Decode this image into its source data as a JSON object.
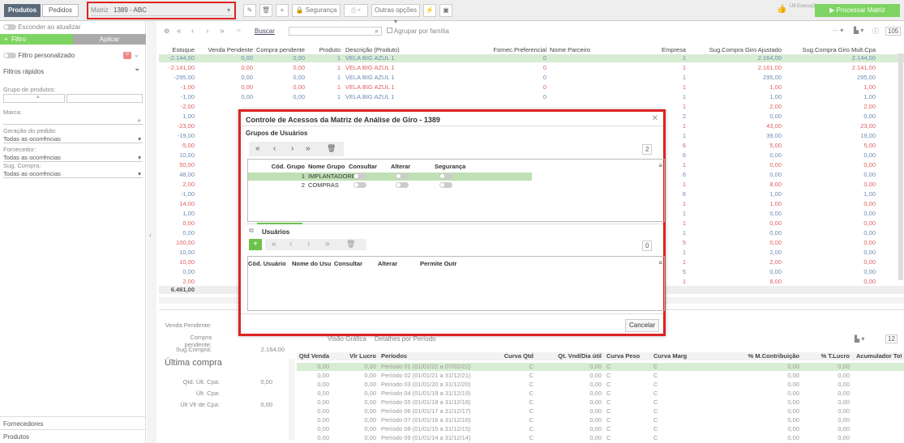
{
  "toolbar": {
    "tab_produtos": "Produtos",
    "tab_pedidos": "Pedidos",
    "matriz_label": "Matriz",
    "matriz_value": "1389 - ABC",
    "seguranca": "Segurança",
    "outras_opcoes": "Outras opções",
    "ult_execucao": "Últ Execução",
    "processar": "Processar Matriz"
  },
  "sidebar": {
    "esconder": "Esconder ao atualizar",
    "filtro_btn": "Filtro",
    "aplicar_btn": "Aplicar",
    "filtro_personalizado": "Filtro personalizado",
    "filtro_badge": "0",
    "filtros_rapidos": "Filtros rápidos",
    "grupo_produtos": "Grupo de produtos:",
    "marca": "Marca:",
    "geracao_pedido": "Geração do pedido:",
    "geracao_value": "Todas as ocorrências",
    "fornecedor": "Fornecedor:",
    "fornecedor_value": "Todas as ocorrências",
    "sug_compra": "Sug. Compra:",
    "sug_value": "Todas as ocorrências",
    "fornecedores": "Fornecedores",
    "produtos": "Produtos"
  },
  "grid_toolbar": {
    "buscar": "Buscar",
    "agrupar": "Agrupar por família",
    "count": "105"
  },
  "grid": {
    "headers": [
      "Estoque",
      "Venda Pendente",
      "Compra pendente",
      "Produto",
      "Descrição (Produto)",
      "Fornec.Preferencial",
      "Nome Parceiro",
      "Empresa",
      "Sug.Compra Giro Ajustado",
      "Sug.Compra Giro Mult.Cpa"
    ],
    "rows": [
      [
        "-2.144,00",
        "0,00",
        "0,00",
        "1",
        "VELA BIG AZUL 1",
        "0",
        "",
        "1",
        "2.164,00",
        "2.144,00"
      ],
      [
        "-2.141,00",
        "0,00",
        "0,00",
        "1",
        "VELA BIG AZUL 1",
        "0",
        "",
        "1",
        "2.161,00",
        "2.141,00"
      ],
      [
        "-295,00",
        "0,00",
        "0,00",
        "1",
        "VELA BIG AZUL 1",
        "0",
        "",
        "1",
        "295,00",
        "295,00"
      ],
      [
        "-1,00",
        "0,00",
        "0,00",
        "1",
        "VELA BIG AZUL 1",
        "0",
        "",
        "1",
        "1,00",
        "1,00"
      ],
      [
        "-1,00",
        "0,00",
        "0,00",
        "1",
        "VELA BIG AZUL 1",
        "0",
        "",
        "1",
        "1,00",
        "1,00"
      ],
      [
        "-2,00",
        "",
        "",
        "",
        "",
        "",
        "",
        "1",
        "2,00",
        "2,00"
      ],
      [
        "1,00",
        "",
        "",
        "",
        "",
        "",
        "",
        "2",
        "0,00",
        "0,00"
      ],
      [
        "-23,00",
        "",
        "",
        "",
        "",
        "",
        "",
        "1",
        "43,00",
        "23,00"
      ],
      [
        "-19,00",
        "",
        "",
        "",
        "",
        "",
        "",
        "1",
        "39,00",
        "19,00"
      ],
      [
        "-5,00",
        "",
        "",
        "",
        "",
        "",
        "",
        "6",
        "5,00",
        "5,00"
      ],
      [
        "10,00",
        "",
        "",
        "",
        "",
        "",
        "",
        "6",
        "0,00",
        "0,00"
      ],
      [
        "50,00",
        "",
        "",
        "",
        "",
        "",
        "",
        "1",
        "0,00",
        "0,00"
      ],
      [
        "48,00",
        "",
        "",
        "",
        "",
        "",
        "",
        "6",
        "0,00",
        "0,00"
      ],
      [
        "2,00",
        "",
        "",
        "",
        "",
        "",
        "",
        "1",
        "8,00",
        "0,00"
      ],
      [
        "-1,00",
        "",
        "",
        "",
        "",
        "",
        "",
        "6",
        "1,00",
        "1,00"
      ],
      [
        "14,00",
        "",
        "",
        "",
        "",
        "",
        "",
        "1",
        "1,00",
        "0,00"
      ],
      [
        "1,00",
        "",
        "",
        "",
        "",
        "",
        "",
        "1",
        "0,00",
        "0,00"
      ],
      [
        "0,00",
        "",
        "",
        "",
        "",
        "",
        "",
        "1",
        "0,00",
        "0,00"
      ],
      [
        "0,00",
        "",
        "",
        "",
        "",
        "",
        "",
        "1",
        "0,00",
        "0,00"
      ],
      [
        "100,00",
        "",
        "",
        "",
        "",
        "",
        "",
        "5",
        "0,00",
        "0,00"
      ],
      [
        "10,00",
        "",
        "",
        "",
        "",
        "",
        "",
        "1",
        "2,00",
        "0,00"
      ],
      [
        "10,00",
        "",
        "",
        "",
        "",
        "",
        "",
        "1",
        "2,00",
        "0,00"
      ],
      [
        "0,00",
        "",
        "",
        "",
        "",
        "",
        "",
        "5",
        "0,00",
        "0,00"
      ],
      [
        "2,00",
        "",
        "",
        "",
        "",
        "",
        "",
        "1",
        "8,00",
        "0,00"
      ]
    ],
    "total": "6.461,00"
  },
  "bottom": {
    "venda_pendente": "Venda Pendente:",
    "compra_pendente": "Compra pendente:",
    "sug_compra": "Sug.Compra:",
    "sug_compra_val": "2.164,00",
    "ultima_compra": "Última compra",
    "qtd_ult": "Qtd. Últ. Cpa:",
    "qtd_ult_val": "0,00",
    "ult_cpa": "Últ. Cpa:",
    "ult_vlr": "Últ Vlr de Cpa:",
    "ult_vlr_val": "0,00",
    "visao_grafica": "Visão Gráfica",
    "detalhes": "Detalhes por Período",
    "page_count": "12",
    "headers": [
      "Qtd Venda",
      "Vlr Lucro",
      "Períodos",
      "Curva Qtd",
      "Qt. Vnd/Dia útil",
      "Curva Peso",
      "Curva Marg",
      "% M.Contribuição",
      "% T.Lucro",
      "Acumulador Total"
    ],
    "rows": [
      [
        "0,00",
        "0,00",
        "Período 01 (01/01/22 a 07/02/22)",
        "C",
        "0,00",
        "C",
        "C",
        "0,00",
        "0,00",
        ""
      ],
      [
        "0,00",
        "0,00",
        "Período 02 (01/01/21 a 31/12/21)",
        "C",
        "0,00",
        "C",
        "C",
        "0,00",
        "0,00",
        ""
      ],
      [
        "0,00",
        "0,00",
        "Período 03 (01/01/20 a 31/12/20)",
        "C",
        "0,00",
        "C",
        "C",
        "0,00",
        "0,00",
        ""
      ],
      [
        "0,00",
        "0,00",
        "Período 04 (01/01/19 a 31/12/19)",
        "C",
        "0,00",
        "C",
        "C",
        "0,00",
        "0,00",
        ""
      ],
      [
        "0,00",
        "0,00",
        "Período 05 (01/01/18 a 31/12/18)",
        "C",
        "0,00",
        "C",
        "C",
        "0,00",
        "0,00",
        ""
      ],
      [
        "0,00",
        "0,00",
        "Período 06 (01/01/17 a 31/12/17)",
        "C",
        "0,00",
        "C",
        "C",
        "0,00",
        "0,00",
        ""
      ],
      [
        "0,00",
        "0,00",
        "Período 07 (01/01/16 a 31/12/16)",
        "C",
        "0,00",
        "C",
        "C",
        "0,00",
        "0,00",
        ""
      ],
      [
        "0,00",
        "0,00",
        "Período 08 (01/01/15 a 31/12/15)",
        "C",
        "0,00",
        "C",
        "C",
        "0,00",
        "0,00",
        ""
      ],
      [
        "0,00",
        "0,00",
        "Período 09 (01/01/14 a 31/12/14)",
        "C",
        "0,00",
        "C",
        "C",
        "0,00",
        "0,00",
        ""
      ]
    ]
  },
  "modal": {
    "title": "Controle de Acessos da Matriz de Análise de Giro - 1389",
    "grupos_title": "Grupos de Usuários",
    "grupos_count": "2",
    "grupos_headers": [
      "Cód. Grupo",
      "Nome Grupo",
      "Consultar",
      "Alterar",
      "Segurança"
    ],
    "grupos_rows": [
      [
        "1",
        "IMPLANTADORES"
      ],
      [
        "2",
        "COMPRAS"
      ]
    ],
    "usuarios_tab": "Usuários",
    "usuarios_count": "0",
    "usuarios_headers": [
      "Cód. Usuário",
      "Nome do Usu",
      "Consultar",
      "Alterar",
      "Permite Outr"
    ],
    "cancelar": "Cancelar"
  },
  "colors": {
    "accent_green": "#6cc24a",
    "highlight_red": "#d22",
    "row_green": "#d7ecd2"
  }
}
